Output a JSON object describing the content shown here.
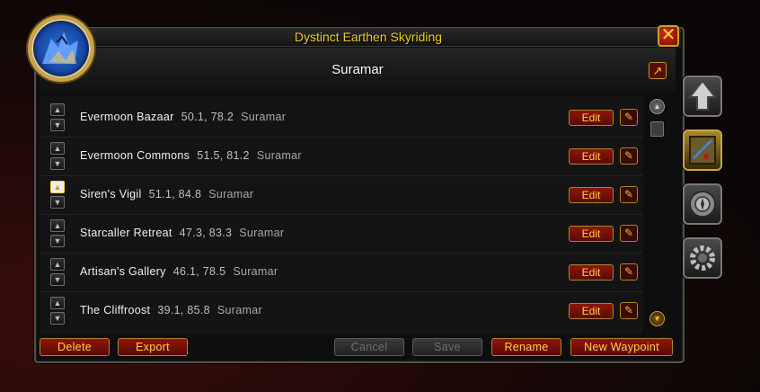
{
  "window": {
    "title": "Dystinct Earthen Skyriding",
    "close_label": "✕",
    "subtitle": "Suramar",
    "share_label": "↗"
  },
  "waypoints": [
    {
      "name": "Evermoon Bazaar",
      "coords": "50.1, 78.2",
      "zone": "Suramar",
      "edit_label": "Edit"
    },
    {
      "name": "Evermoon Commons",
      "coords": "51.5, 81.2",
      "zone": "Suramar",
      "edit_label": "Edit"
    },
    {
      "name": "Siren's Vigil",
      "coords": "51.1, 84.8",
      "zone": "Suramar",
      "edit_label": "Edit"
    },
    {
      "name": "Starcaller Retreat",
      "coords": "47.3, 83.3",
      "zone": "Suramar",
      "edit_label": "Edit"
    },
    {
      "name": "Artisan's Gallery",
      "coords": "46.1, 78.5",
      "zone": "Suramar",
      "edit_label": "Edit"
    },
    {
      "name": "The Cliffroost",
      "coords": "39.1, 85.8",
      "zone": "Suramar",
      "edit_label": "Edit"
    }
  ],
  "bottom": {
    "delete": "Delete",
    "export": "Export",
    "cancel": "Cancel",
    "save": "Save",
    "rename": "Rename",
    "new_waypoint": "New Waypoint"
  },
  "icons": {
    "portrait": "dragon-portrait-icon",
    "move_up": "arrow-up-icon",
    "move_down": "arrow-down-icon",
    "row_action": "edit-waypoint-icon",
    "tabs": [
      "upgrade-arrow-icon",
      "map-quest-icon",
      "compass-icon",
      "gear-icon"
    ]
  },
  "colors": {
    "title": "#f1cc22",
    "button_red": "#8d1608",
    "button_border": "#a8852e",
    "button_text": "#ffd24a"
  }
}
